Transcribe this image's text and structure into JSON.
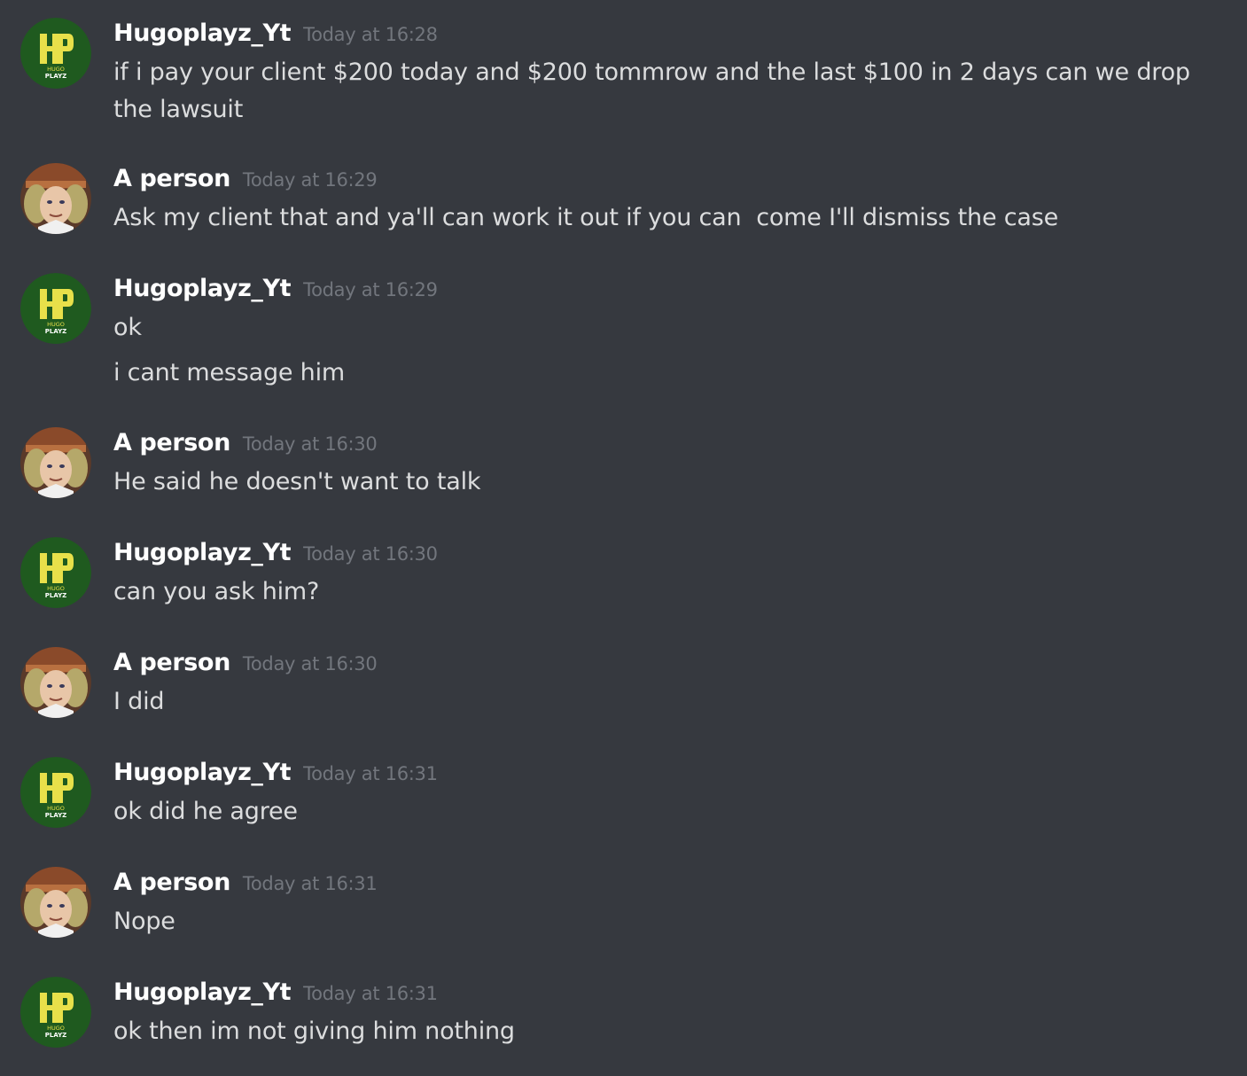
{
  "users": {
    "hugo": {
      "name": "Hugoplayz_Yt",
      "avatar_label_top": "HUGO",
      "avatar_label_bottom": "PLAYZ",
      "avatar_color": "#1f5a1f",
      "avatar_letters": "HP"
    },
    "person": {
      "name": "A person",
      "avatar_bg": "#c07a4a"
    }
  },
  "messages": [
    {
      "author": "Hugoplayz_Yt",
      "user": "hugo",
      "time": "Today at 16:28",
      "lines": [
        "if i pay your client $200 today and $200 tommrow and the last $100 in 2 days can we drop the lawsuit"
      ]
    },
    {
      "author": "A person",
      "user": "person",
      "time": "Today at 16:29",
      "lines": [
        "Ask my client that and ya'll can work it out if you can  come I'll dismiss the case"
      ]
    },
    {
      "author": "Hugoplayz_Yt",
      "user": "hugo",
      "time": "Today at 16:29",
      "lines": [
        "ok",
        "i cant message him"
      ]
    },
    {
      "author": "A person",
      "user": "person",
      "time": "Today at 16:30",
      "lines": [
        "He said he doesn't want to talk"
      ]
    },
    {
      "author": "Hugoplayz_Yt",
      "user": "hugo",
      "time": "Today at 16:30",
      "lines": [
        "can you ask him?"
      ]
    },
    {
      "author": "A person",
      "user": "person",
      "time": "Today at 16:30",
      "lines": [
        "I did"
      ]
    },
    {
      "author": "Hugoplayz_Yt",
      "user": "hugo",
      "time": "Today at 16:31",
      "lines": [
        "ok did he agree"
      ]
    },
    {
      "author": "A person",
      "user": "person",
      "time": "Today at 16:31",
      "lines": [
        "Nope"
      ]
    },
    {
      "author": "Hugoplayz_Yt",
      "user": "hugo",
      "time": "Today at 16:31",
      "lines": [
        "ok then im not giving him nothing"
      ]
    }
  ],
  "colors": {
    "background": "#36393f",
    "username": "#ffffff",
    "timestamp": "#72767d",
    "text": "#dcddde",
    "hugo_letters": "#e8e04a"
  }
}
